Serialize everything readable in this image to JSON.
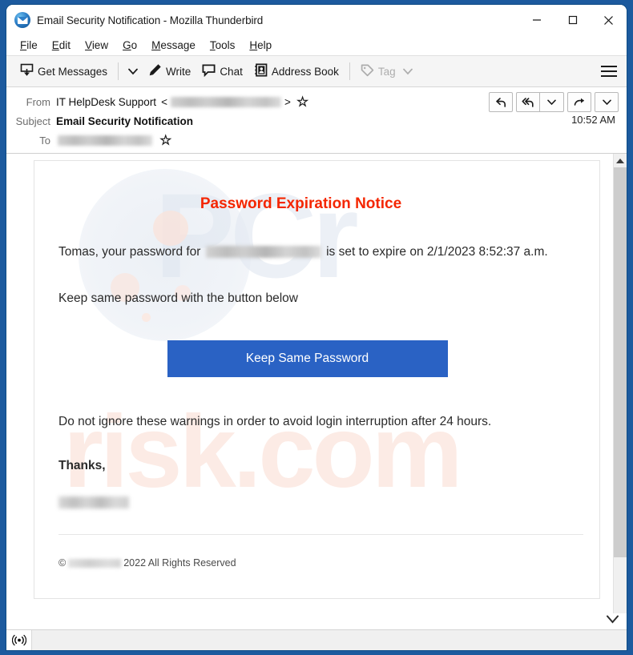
{
  "window": {
    "title": "Email Security Notification - Mozilla Thunderbird",
    "app_icon": "thunderbird-icon",
    "controls": {
      "minimize": "minimize-icon",
      "maximize": "maximize-icon",
      "close": "close-icon"
    }
  },
  "menubar": {
    "items": [
      {
        "label": "File",
        "accesskey": "F",
        "rest": "ile"
      },
      {
        "label": "Edit",
        "accesskey": "E",
        "rest": "dit"
      },
      {
        "label": "View",
        "accesskey": "V",
        "rest": "iew"
      },
      {
        "label": "Go",
        "accesskey": "G",
        "rest": "o"
      },
      {
        "label": "Message",
        "accesskey": "M",
        "rest": "essage"
      },
      {
        "label": "Tools",
        "accesskey": "T",
        "rest": "ools"
      },
      {
        "label": "Help",
        "accesskey": "H",
        "rest": "elp"
      }
    ]
  },
  "toolbar": {
    "get_messages": "Get Messages",
    "write": "Write",
    "chat": "Chat",
    "address_book": "Address Book",
    "tag": "Tag",
    "tag_disabled": true,
    "menu_icon": "hamburger-menu-icon"
  },
  "message_header": {
    "from_label": "From",
    "from_name": "IT HelpDesk Support",
    "from_bracket_open": "<",
    "from_bracket_close": ">",
    "from_address_redacted": true,
    "subject_label": "Subject",
    "subject": "Email Security Notification",
    "to_label": "To",
    "to_address_redacted": true,
    "time": "10:52 AM",
    "actions": [
      {
        "name": "reply-button",
        "icon": "reply-arrow-icon"
      },
      {
        "name": "reply-all-button",
        "icon": "reply-all-arrow-icon"
      },
      {
        "name": "reply-all-dropdown",
        "icon": "chevron-down-icon"
      },
      {
        "name": "forward-button",
        "icon": "forward-arrow-icon"
      },
      {
        "name": "more-actions-dropdown",
        "icon": "chevron-down-icon"
      }
    ]
  },
  "email_body": {
    "heading": "Password Expiration Notice",
    "heading_color": "#f42600",
    "intro_before": "Tomas, your password for",
    "intro_after": "is set to expire on 2/1/2023 8:52:37 a.m.",
    "keep_line": "Keep same password with the button below",
    "cta_label": "Keep Same Password",
    "cta_color": "#2a62c4",
    "warning": "Do not ignore these warnings in order to avoid login interruption after 24 hours.",
    "thanks": "Thanks,",
    "signature_redacted": true,
    "copyright_symbol": "©",
    "copyright_year_text": "2022 All Rights Reserved"
  },
  "watermark": {
    "text_top": "PCr",
    "text_bottom": "risk.com"
  },
  "scrollbar": {
    "up_arrow": "scroll-up-arrow-icon",
    "down_arrow": "scroll-down-arrow-icon"
  },
  "statusbar": {
    "connection_icon": "online-indicator-icon",
    "text": ""
  }
}
